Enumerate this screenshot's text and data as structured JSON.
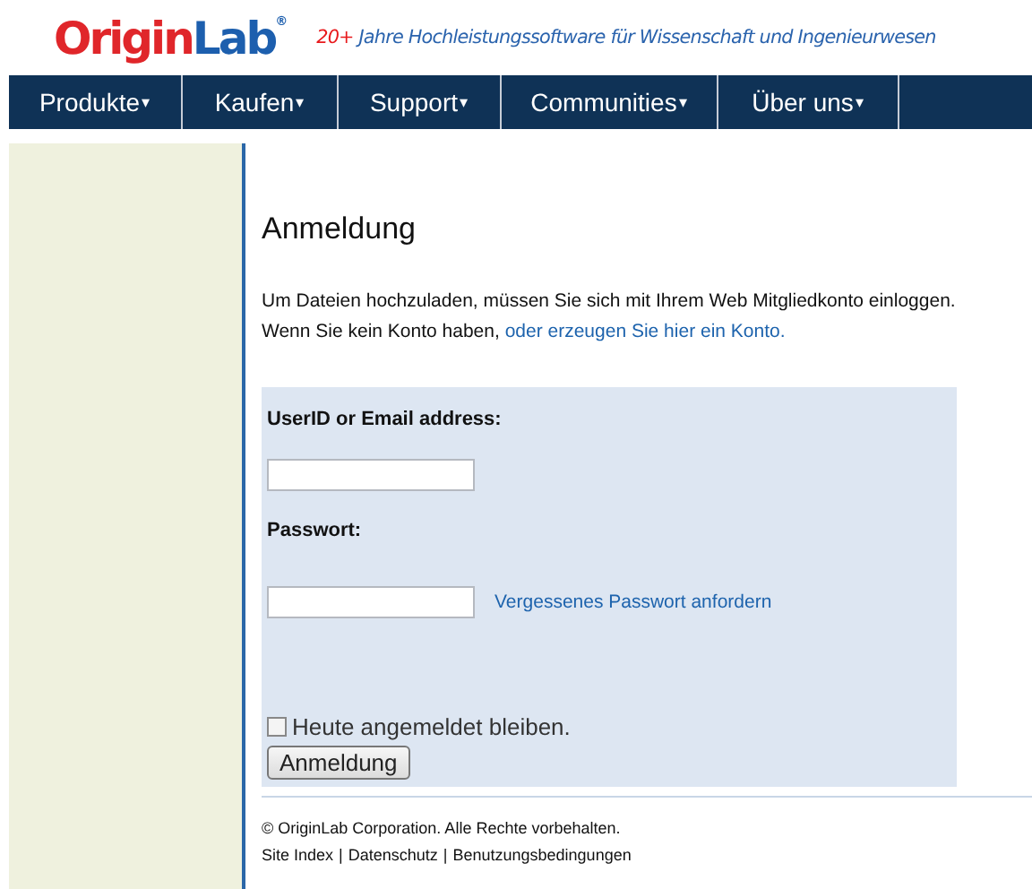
{
  "header": {
    "logo": {
      "part_1": "Origin",
      "part_2": "Lab",
      "mark": "®"
    },
    "tagline": {
      "number": "20+",
      "text": "Jahre Hochleistungssoftware für Wissenschaft und Ingenieurwesen"
    }
  },
  "nav": {
    "items": [
      {
        "label": "Produkte",
        "caret": "▾"
      },
      {
        "label": "Kaufen",
        "caret": "▾"
      },
      {
        "label": "Support",
        "caret": "▾"
      },
      {
        "label": "Communities",
        "caret": "▾"
      },
      {
        "label": "Über uns",
        "caret": "▾"
      }
    ]
  },
  "content": {
    "title": "Anmeldung",
    "intro": {
      "line_1": "Um Dateien hochzuladen, müssen Sie sich mit Ihrem Web Mitgliedkonto einloggen.",
      "line_2": "Wenn Sie kein Konto haben,",
      "link": "oder erzeugen Sie hier ein Konto."
    },
    "form": {
      "user_label": "UserID or Email address:",
      "password_label": "Passwort:",
      "forgot_link": "Vergessenes Passwort anfordern",
      "remember": {
        "label": "Heute angemeldet bleiben.",
        "checked": false
      },
      "submit": "Anmeldung"
    }
  },
  "footer": {
    "copyright": "© OriginLab Corporation. Alle Rechte vorbehalten.",
    "links": [
      "Site Index",
      "Datenschutz",
      "Benutzungsbedingungen"
    ],
    "separator": "|"
  }
}
